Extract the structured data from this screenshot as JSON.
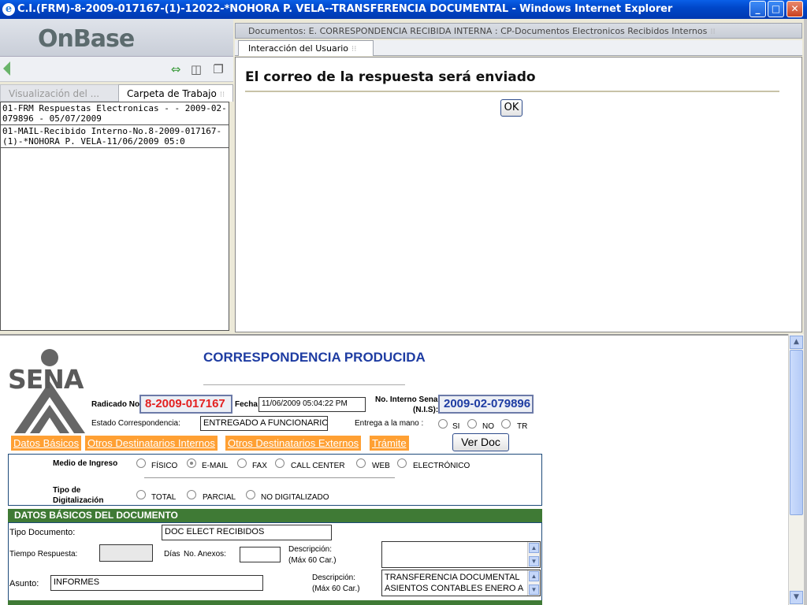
{
  "window": {
    "title": "C.I.(FRM)-8-2009-017167-(1)-12022-*NOHORA P. VELA--TRANSFERENCIA DOCUMENTAL - Windows Internet Explorer",
    "ie_glyph": "e",
    "min": "_",
    "max": "□",
    "close": "✕"
  },
  "sidebar": {
    "logo": "OnBase",
    "tabs": [
      {
        "label": "Visualización del ..."
      },
      {
        "label": "Carpeta de Trabajo"
      }
    ],
    "documents": [
      "01-FRM Respuestas Electronicas - - 2009-02-079896 - 05/07/2009",
      "01-MAIL-Recibido Interno-No.8-2009-017167-(1)-*NOHORA P. VELA-11/06/2009 05:0"
    ]
  },
  "main": {
    "doc_tab": "Documentos: E. CORRESPONDENCIA RECIBIDA INTERNA : CP-Documentos Electronicos Recibidos Internos",
    "interaction_tab": "Interacción del Usuario",
    "message": "El correo de la respuesta será enviado",
    "ok_label": "OK"
  },
  "form": {
    "logo_text": "SENA",
    "title": "CORRESPONDENCIA PRODUCIDA",
    "radicado_label": "Radicado No",
    "radicado": "8-2009-017167",
    "fecha_label": "Fecha",
    "fecha": "11/06/2009 05:04:22 PM",
    "interno_label": "No. Interno Sena",
    "interno_sub": "(N.I.S):",
    "interno": "2009-02-079896",
    "estado_label": "Estado Correspondencia:",
    "estado": "ENTREGADO A FUNCIONARIO",
    "entrega_label": "Entrega a la mano :",
    "entrega_opts": [
      "SI",
      "NO",
      "TR"
    ],
    "tabs": [
      "Datos Básicos",
      "Otros Destinatarios Internos",
      "Otros Destinatarios Externos",
      "Trámite"
    ],
    "ver_doc": "Ver Doc",
    "medio_label": "Medio de Ingreso",
    "medio_opts": [
      "FÍSICO",
      "E-MAIL",
      "FAX",
      "CALL CENTER",
      "WEB",
      "ELECTRÓNICO"
    ],
    "medio_selected": "E-MAIL",
    "tipo_dig_label1": "Tipo de",
    "tipo_dig_label2": "Digitalización",
    "tipo_dig_opts": [
      "TOTAL",
      "PARCIAL",
      "NO DIGITALIZADO"
    ],
    "section": "DATOS BÁSICOS DEL DOCUMENTO",
    "tipo_doc_label": "Tipo Documento:",
    "tipo_doc": "DOC ELECT RECIBIDOS",
    "tiempo_label": "Tiempo Respuesta:",
    "dias_label": "Días",
    "anexos_label": "No. Anexos:",
    "desc_label1": "Descripción:",
    "desc_label2": "(Máx 60 Car.)",
    "asunto_label": "Asunto:",
    "asunto": "INFORMES",
    "desc_text1": "TRANSFERENCIA DOCUMENTAL",
    "desc_text2": "ASIENTOS CONTABLES ENERO A"
  }
}
